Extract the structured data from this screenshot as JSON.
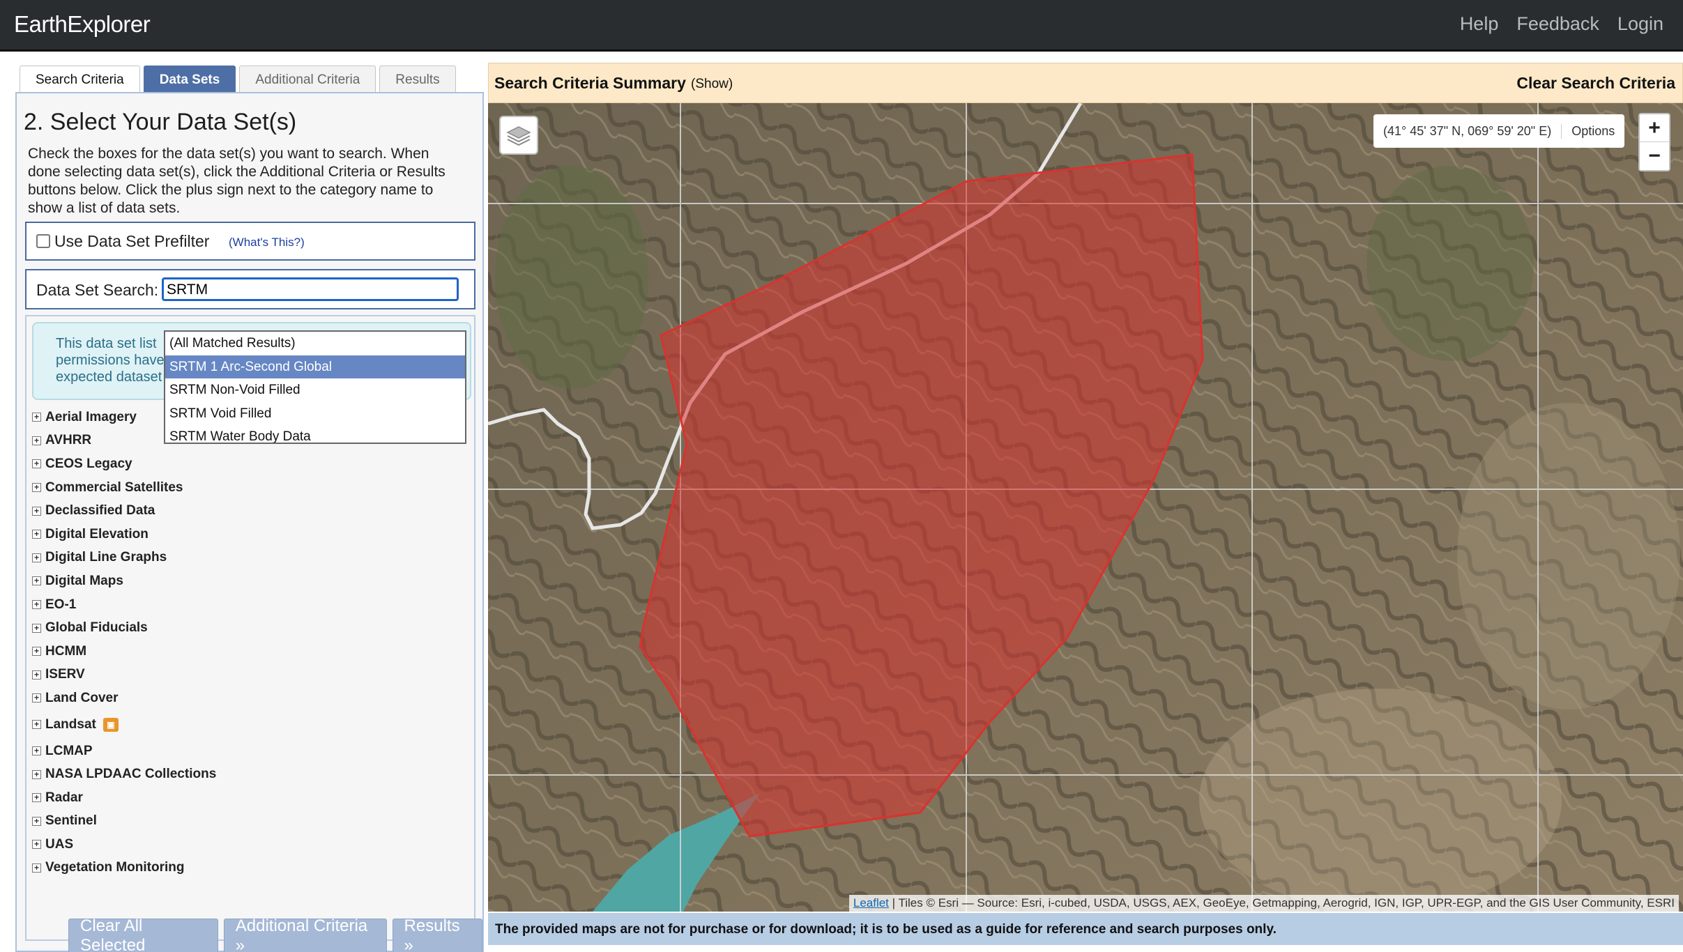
{
  "header": {
    "brand": "EarthExplorer",
    "nav": [
      "Help",
      "Feedback",
      "Login"
    ]
  },
  "tabs": [
    "Search Criteria",
    "Data Sets",
    "Additional Criteria",
    "Results"
  ],
  "active_tab": "Data Sets",
  "panel": {
    "title": "2. Select Your Data Set(s)",
    "instructions_lines": [
      "Check the boxes for the data set(s) you want to search. When",
      "done selecting data set(s), click the Additional Criteria or Results",
      "buttons below. Click the plus sign next to the category name to",
      "show a list of data sets."
    ],
    "prefilter_label": "Use Data Set Prefilter",
    "prefilter_help": "(What's This?)",
    "prefilter_checked": false,
    "search_label": "Data Set Search:",
    "search_value": "SRTM",
    "notice_lines": [
      "This data set list",
      "permissions have",
      "expected dataset"
    ]
  },
  "dropdown": {
    "options": [
      "(All Matched Results)",
      "SRTM 1 Arc-Second Global",
      "SRTM Non-Void Filled",
      "SRTM Void Filled",
      "SRTM Water Body Data"
    ],
    "highlighted": "SRTM 1 Arc-Second Global"
  },
  "categories": [
    "Aerial Imagery",
    "AVHRR",
    "CEOS Legacy",
    "Commercial Satellites",
    "Declassified Data",
    "Digital Elevation",
    "Digital Line Graphs",
    "Digital Maps",
    "EO-1",
    "Global Fiducials",
    "HCMM",
    "ISERV",
    "Land Cover",
    "Landsat",
    "LCMAP",
    "NASA LPDAAC Collections",
    "Radar",
    "Sentinel",
    "UAS",
    "Vegetation Monitoring"
  ],
  "buttons": {
    "clear": "Clear All Selected",
    "additional": "Additional Criteria »",
    "results": "Results »"
  },
  "summary": {
    "title": "Search Criteria Summary",
    "show": "(Show)",
    "clear": "Clear Search Criteria"
  },
  "map": {
    "coords": "(41° 45' 37\" N, 069° 59' 20\" E)",
    "options": "Options",
    "zoom_in": "+",
    "zoom_out": "−",
    "attribution_link": "Leaflet",
    "attribution_text": " | Tiles © Esri — Source: Esri, i-cubed, USDA, USGS, AEX, GeoEye, Getmapping, Aerogrid, IGN, IGP, UPR-EGP, and the GIS User Community, ESRI",
    "polygon_color": "#d8332f"
  },
  "footer": "The provided maps are not for purchase or for download; it is to be used as a guide for reference and search purposes only."
}
